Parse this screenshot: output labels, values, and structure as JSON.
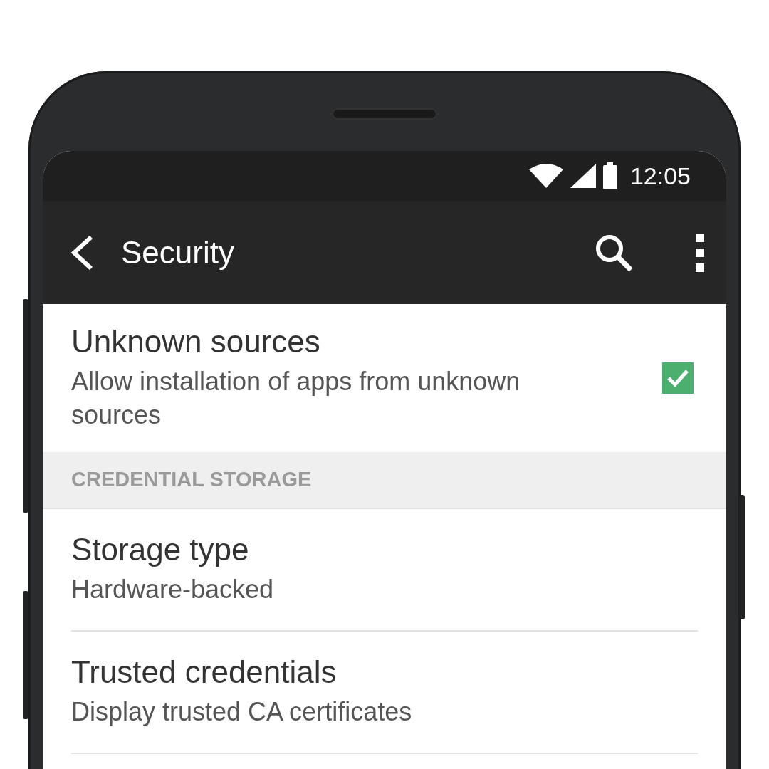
{
  "status_bar": {
    "time": "12:05"
  },
  "app_bar": {
    "title": "Security"
  },
  "settings": [
    {
      "kind": "toggle",
      "title": "Unknown sources",
      "summary": "Allow installation of apps from unknown sources",
      "checked": true
    },
    {
      "kind": "header",
      "title": "CREDENTIAL STORAGE"
    },
    {
      "kind": "item",
      "title": "Storage type",
      "summary": "Hardware-backed"
    },
    {
      "kind": "item",
      "title": "Trusted credentials",
      "summary": "Display trusted CA certificates"
    }
  ]
}
